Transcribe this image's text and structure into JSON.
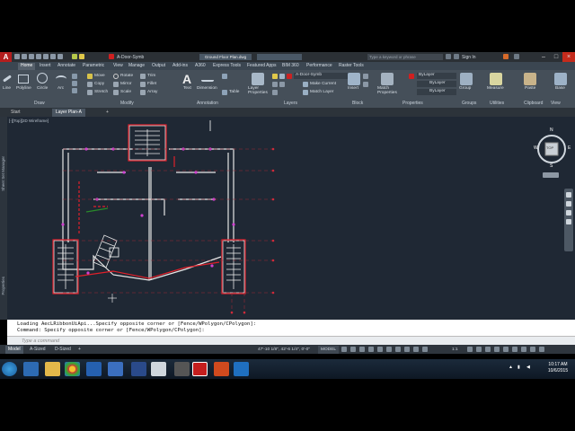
{
  "titlebar": {
    "quick_layer": "A-Door-Symb",
    "doc_title": "Ground Floor Plan.dwg",
    "search_placeholder": "Type a keyword or phrase",
    "sign_in": "Sign In"
  },
  "ribbon_tabs": [
    "Home",
    "Insert",
    "Annotate",
    "Parametric",
    "View",
    "Manage",
    "Output",
    "Add-ins",
    "A360",
    "Express Tools",
    "Featured Apps",
    "BIM 360",
    "Performance",
    "Raster Tools"
  ],
  "ribbon": {
    "draw": {
      "label": "Draw",
      "line": "Line",
      "polyline": "Polyline",
      "circle": "Circle",
      "arc": "Arc"
    },
    "modify": {
      "label": "Modify",
      "move": "Move",
      "rotate": "Rotate",
      "trim": "Trim",
      "copy": "Copy",
      "mirror": "Mirror",
      "fillet": "Fillet",
      "stretch": "Stretch",
      "scale": "Scale",
      "array": "Array"
    },
    "annotation": {
      "label": "Annotation",
      "text": "Text",
      "dimension": "Dimension",
      "table": "Table"
    },
    "layers": {
      "label": "Layers",
      "layer_properties": "Layer Properties",
      "layer_name": "A-Door-Symb",
      "make_current": "Make Current",
      "match_layer": "Match Layer"
    },
    "block": {
      "label": "Block",
      "insert": "Insert"
    },
    "properties": {
      "label": "Properties",
      "match_properties": "Match Properties",
      "bylayer1": "ByLayer",
      "bylayer2": "ByLayer",
      "bylayer3": "ByLayer"
    },
    "groups": {
      "label": "Groups",
      "group": "Group"
    },
    "utilities": {
      "label": "Utilities",
      "measure": "Measure"
    },
    "clipboard": {
      "label": "Clipboard",
      "paste": "Paste"
    },
    "view": {
      "label": "View",
      "base": "Base"
    }
  },
  "file_tabs": [
    "Start",
    "Layer Plan-A"
  ],
  "viewport_label": "[-][Top][2D Wireframe]",
  "palette_labels": [
    "Sheet Set Manager",
    "Properties"
  ],
  "viewcube": {
    "top": "TOP",
    "n": "N",
    "s": "S",
    "e": "E",
    "w": "W"
  },
  "command": {
    "line1": "Loading AecLRibbonUiApi...Specify opposite corner or [Fence/WPolygon/CPolygon]:",
    "line2": "Command: Specify opposite corner or [Fence/WPolygon/CPolygon]:",
    "placeholder": "Type a command"
  },
  "layout_tabs": [
    "Model",
    "A-Sized",
    "D-Sized"
  ],
  "status": {
    "coords": "47'-10 1/8\", 42'-6 1/4\", 0'-0\"",
    "mode": "MODEL",
    "scale": "1:1"
  },
  "taskbar": {
    "time": "10:17 AM",
    "date": "10/6/2015"
  }
}
